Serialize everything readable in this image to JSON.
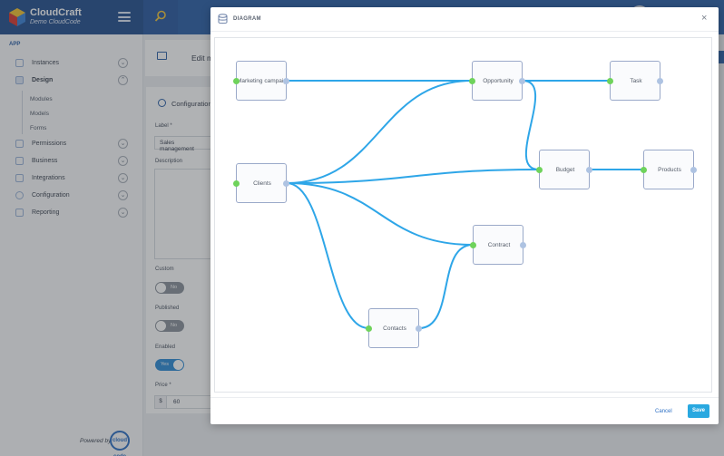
{
  "app": {
    "brand_name": "CloudCraft",
    "brand_sub": "Demo CloudCode"
  },
  "sidebar": {
    "section": "APP",
    "items": [
      {
        "label": "Instances",
        "icon": "cube-icon"
      },
      {
        "label": "Design",
        "icon": "palette-icon"
      },
      {
        "label": "Permissions",
        "icon": "lock-icon"
      },
      {
        "label": "Business",
        "icon": "briefcase-icon"
      },
      {
        "label": "Integrations",
        "icon": "plug-icon"
      },
      {
        "label": "Configuration",
        "icon": "gear-icon"
      },
      {
        "label": "Reporting",
        "icon": "chart-icon"
      }
    ],
    "design_subitems": [
      "Modules",
      "Models",
      "Forms"
    ],
    "powered_by": "Powered by",
    "powered_logo": "cloud code"
  },
  "page": {
    "edit_title": "Edit m",
    "config_title": "Configuration",
    "label_field": "Label *",
    "label_value": "Sales management",
    "description_field": "Description",
    "custom_field": "Custom",
    "custom_value": "No",
    "published_field": "Published",
    "published_value": "No",
    "enabled_field": "Enabled",
    "enabled_value": "Yes",
    "price_field": "Price *",
    "price_prefix": "$",
    "price_value": "60"
  },
  "modal": {
    "title": "DIAGRAM",
    "close": "×",
    "cancel_label": "Cancel",
    "save_label": "Save"
  },
  "diagram": {
    "nodes": [
      {
        "id": "marketing",
        "label": "Marketing campaign"
      },
      {
        "id": "opportunity",
        "label": "Opportunity"
      },
      {
        "id": "task",
        "label": "Task"
      },
      {
        "id": "clients",
        "label": "Clients"
      },
      {
        "id": "budget",
        "label": "Budget"
      },
      {
        "id": "products",
        "label": "Products"
      },
      {
        "id": "contract",
        "label": "Contract"
      },
      {
        "id": "contacts",
        "label": "Contacts"
      }
    ],
    "edges": [
      {
        "from": "marketing",
        "to": "opportunity"
      },
      {
        "from": "opportunity",
        "to": "task"
      },
      {
        "from": "opportunity",
        "to": "budget"
      },
      {
        "from": "clients",
        "to": "opportunity"
      },
      {
        "from": "clients",
        "to": "budget"
      },
      {
        "from": "clients",
        "to": "contract"
      },
      {
        "from": "clients",
        "to": "contacts"
      },
      {
        "from": "contacts",
        "to": "contract"
      },
      {
        "from": "budget",
        "to": "products"
      }
    ],
    "edge_color": "#2ea6e8"
  }
}
